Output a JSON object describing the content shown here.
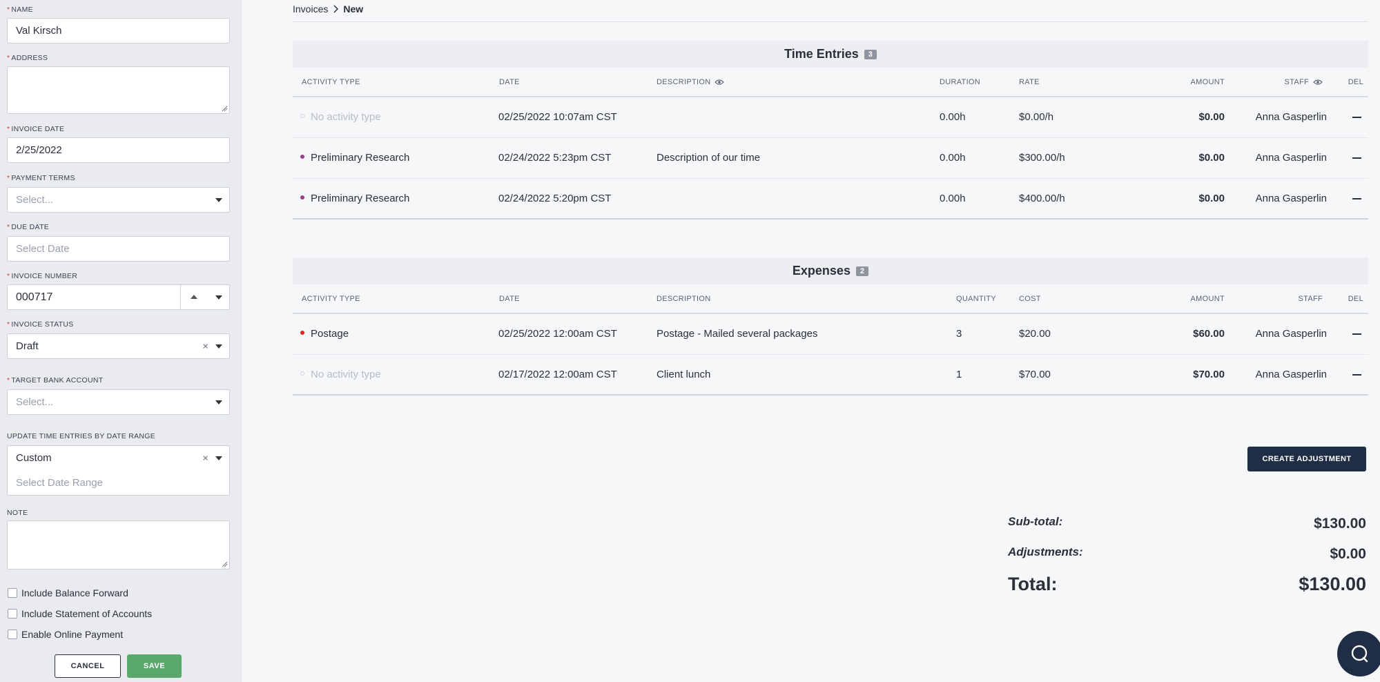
{
  "sidebar": {
    "name": {
      "label": "NAME",
      "value": "Val Kirsch"
    },
    "address": {
      "label": "ADDRESS",
      "value": ""
    },
    "invoice_date": {
      "label": "INVOICE DATE",
      "value": "2/25/2022"
    },
    "payment_terms": {
      "label": "PAYMENT TERMS",
      "placeholder": "Select..."
    },
    "due_date": {
      "label": "DUE DATE",
      "placeholder": "Select Date"
    },
    "invoice_number": {
      "label": "INVOICE NUMBER",
      "value": "000717"
    },
    "invoice_status": {
      "label": "INVOICE STATUS",
      "value": "Draft"
    },
    "target_bank_account": {
      "label": "TARGET BANK ACCOUNT",
      "placeholder": "Select..."
    },
    "date_range": {
      "label": "UPDATE TIME ENTRIES BY DATE RANGE",
      "value": "Custom",
      "placeholder": "Select Date Range"
    },
    "note": {
      "label": "NOTE",
      "value": ""
    },
    "checkboxes": [
      {
        "label": "Include Balance Forward",
        "checked": false
      },
      {
        "label": "Include Statement of Accounts",
        "checked": false
      },
      {
        "label": "Enable Online Payment",
        "checked": false
      }
    ],
    "cancel_label": "CANCEL",
    "save_label": "SAVE"
  },
  "breadcrumb": {
    "parent": "Invoices",
    "separator": ">",
    "current": "New"
  },
  "time_entries": {
    "title": "Time Entries",
    "count": "3",
    "columns": {
      "activity": "ACTIVITY TYPE",
      "date": "DATE",
      "description": "DESCRIPTION",
      "duration": "DURATION",
      "rate": "RATE",
      "amount": "AMOUNT",
      "staff": "STAFF",
      "del": "DEL"
    },
    "rows": [
      {
        "activity": "No activity type",
        "date": "02/25/2022 10:07am CST",
        "description": "",
        "duration": "0.00h",
        "rate": "$0.00/h",
        "amount": "$0.00",
        "staff": "Anna Gasperlin"
      },
      {
        "activity": "Preliminary Research",
        "date": "02/24/2022 5:23pm CST",
        "description": "Description of our time",
        "duration": "0.00h",
        "rate": "$300.00/h",
        "amount": "$0.00",
        "staff": "Anna Gasperlin"
      },
      {
        "activity": "Preliminary Research",
        "date": "02/24/2022 5:20pm CST",
        "description": "",
        "duration": "0.00h",
        "rate": "$400.00/h",
        "amount": "$0.00",
        "staff": "Anna Gasperlin"
      }
    ]
  },
  "expenses": {
    "title": "Expenses",
    "count": "2",
    "columns": {
      "activity": "ACTIVITY TYPE",
      "date": "DATE",
      "description": "DESCRIPTION",
      "quantity": "QUANTITY",
      "cost": "COST",
      "amount": "AMOUNT",
      "staff": "STAFF",
      "del": "DEL"
    },
    "rows": [
      {
        "activity": "Postage",
        "date": "02/25/2022 12:00am CST",
        "description": "Postage - Mailed several packages",
        "quantity": "3",
        "cost": "$20.00",
        "amount": "$60.00",
        "staff": "Anna Gasperlin"
      },
      {
        "activity": "No activity type",
        "date": "02/17/2022 12:00am CST",
        "description": "Client lunch",
        "quantity": "1",
        "cost": "$70.00",
        "amount": "$70.00",
        "staff": "Anna Gasperlin"
      }
    ]
  },
  "create_adjustment_label": "CREATE ADJUSTMENT",
  "totals": {
    "subtotal_label": "Sub-total:",
    "subtotal": "$130.00",
    "adjustments_label": "Adjustments:",
    "adjustments": "$0.00",
    "total_label": "Total:",
    "total": "$130.00"
  },
  "colors": {
    "accent_dark": "#1f2d45",
    "save_green": "#5aa86c",
    "required_red": "#d23b3b",
    "activity_purple": "#9b3d8a",
    "postage_red": "#e02424"
  },
  "icons": [
    "chevron-right-icon",
    "eye-icon",
    "caret-down-icon",
    "caret-up-icon",
    "clear-icon",
    "minus-icon",
    "chat-icon",
    "resize-grip-icon"
  ]
}
